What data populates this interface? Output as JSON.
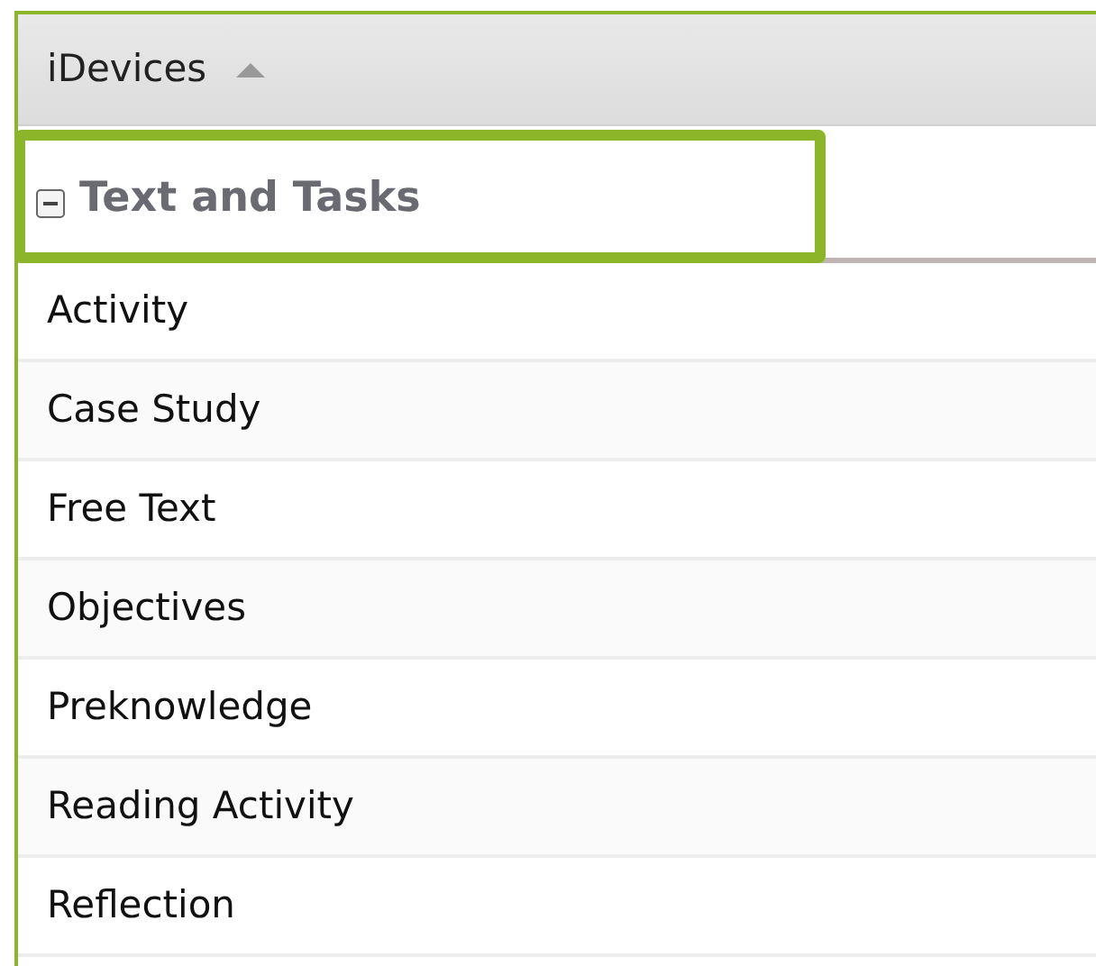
{
  "grid": {
    "column": {
      "label": "iDevices",
      "sorted_ascending": true
    },
    "group": {
      "label": "Text and Tasks",
      "expanded": true,
      "highlighted": true
    },
    "rows": [
      {
        "label": "Activity"
      },
      {
        "label": "Case Study"
      },
      {
        "label": "Free Text"
      },
      {
        "label": "Objectives"
      },
      {
        "label": "Preknowledge"
      },
      {
        "label": "Reading Activity"
      },
      {
        "label": "Reflection"
      }
    ]
  }
}
